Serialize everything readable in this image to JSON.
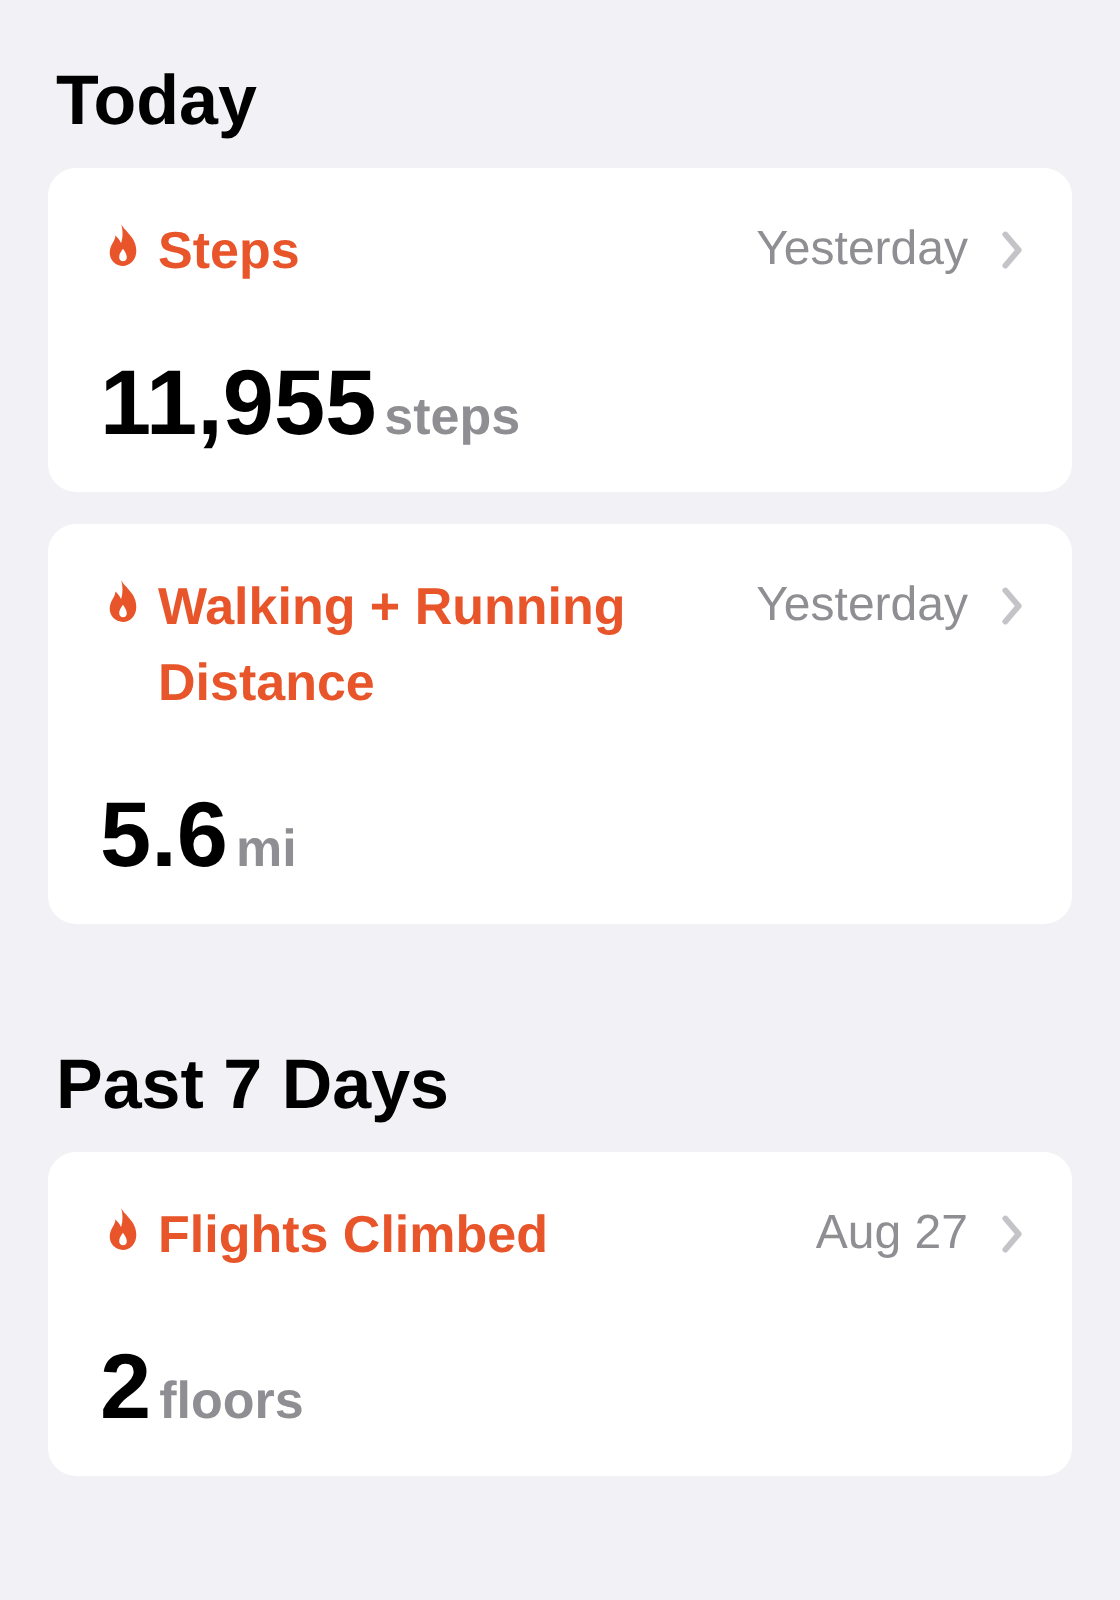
{
  "sections": [
    {
      "title": "Today",
      "cards": [
        {
          "title": "Steps",
          "date": "Yesterday",
          "value": "11,955",
          "unit": "steps"
        },
        {
          "title": "Walking + Running Distance",
          "date": "Yesterday",
          "value": "5.6",
          "unit": "mi"
        }
      ]
    },
    {
      "title": "Past 7 Days",
      "cards": [
        {
          "title": "Flights Climbed",
          "date": "Aug 27",
          "value": "2",
          "unit": "floors"
        }
      ]
    }
  ]
}
